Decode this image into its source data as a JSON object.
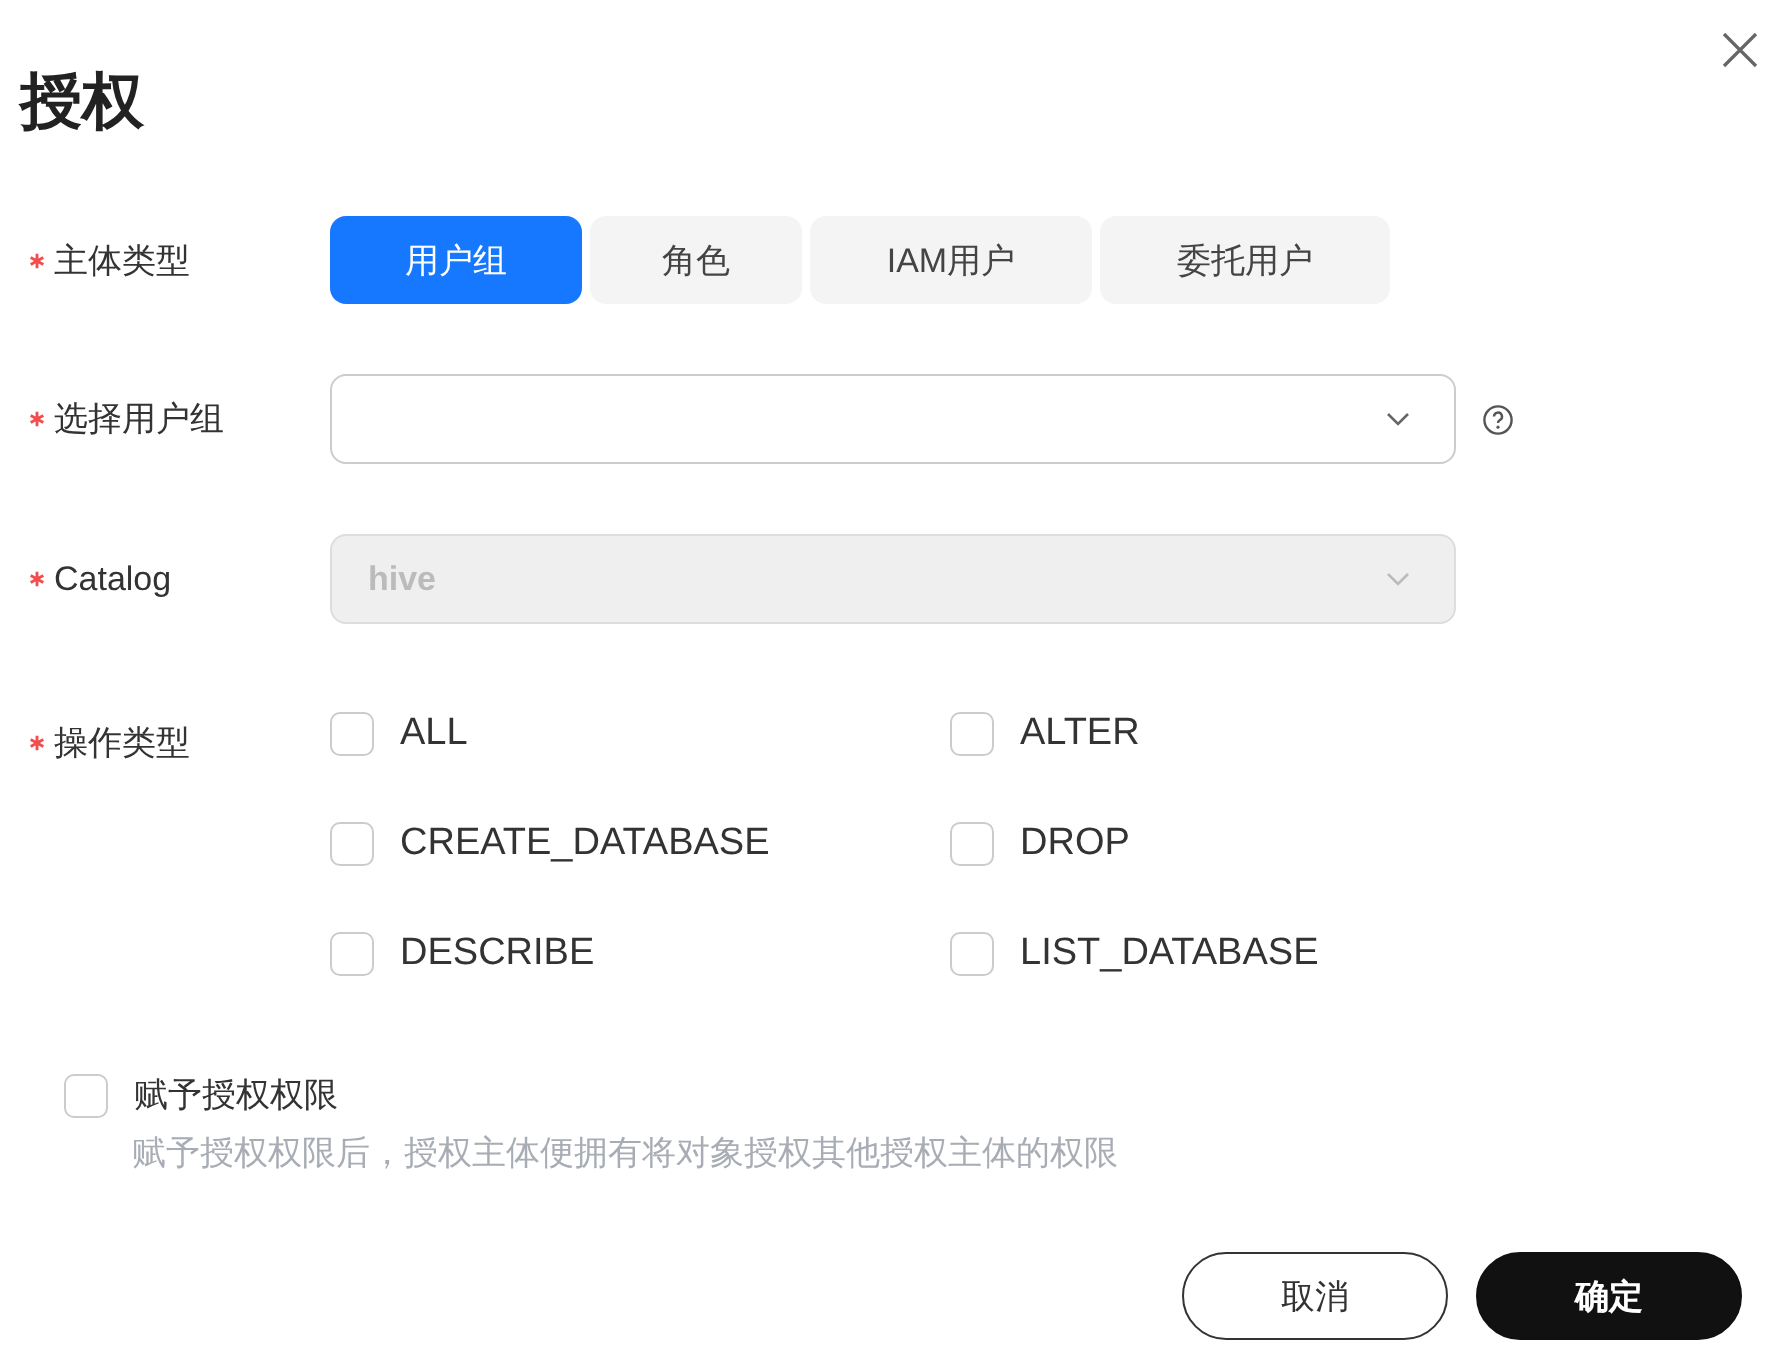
{
  "dialog": {
    "title": "授权"
  },
  "subject_type": {
    "label": "主体类型",
    "required": true,
    "options": [
      {
        "label": "用户组",
        "selected": true
      },
      {
        "label": "角色",
        "selected": false
      },
      {
        "label": "IAM用户",
        "selected": false
      },
      {
        "label": "委托用户",
        "selected": false
      }
    ]
  },
  "user_group": {
    "label": "选择用户组",
    "required": true,
    "disabled": false
  },
  "catalog": {
    "label": "Catalog",
    "required": true,
    "value": "hive",
    "disabled": true
  },
  "operation_type": {
    "label": "操作类型",
    "required": true,
    "options": [
      {
        "label": "ALL",
        "checked": false
      },
      {
        "label": "ALTER",
        "checked": false
      },
      {
        "label": "CREATE_DATABASE",
        "checked": false
      },
      {
        "label": "DROP",
        "checked": false
      },
      {
        "label": "DESCRIBE",
        "checked": false
      },
      {
        "label": "LIST_DATABASE",
        "checked": false
      }
    ]
  },
  "grant_permission": {
    "label": "赋予授权权限",
    "checked": false,
    "description": "赋予授权权限后，授权主体便拥有将对象授权其他授权主体的权限"
  },
  "buttons": [
    {
      "label": "取消",
      "kind": "secondary"
    },
    {
      "label": "确定",
      "kind": "primary"
    }
  ]
}
